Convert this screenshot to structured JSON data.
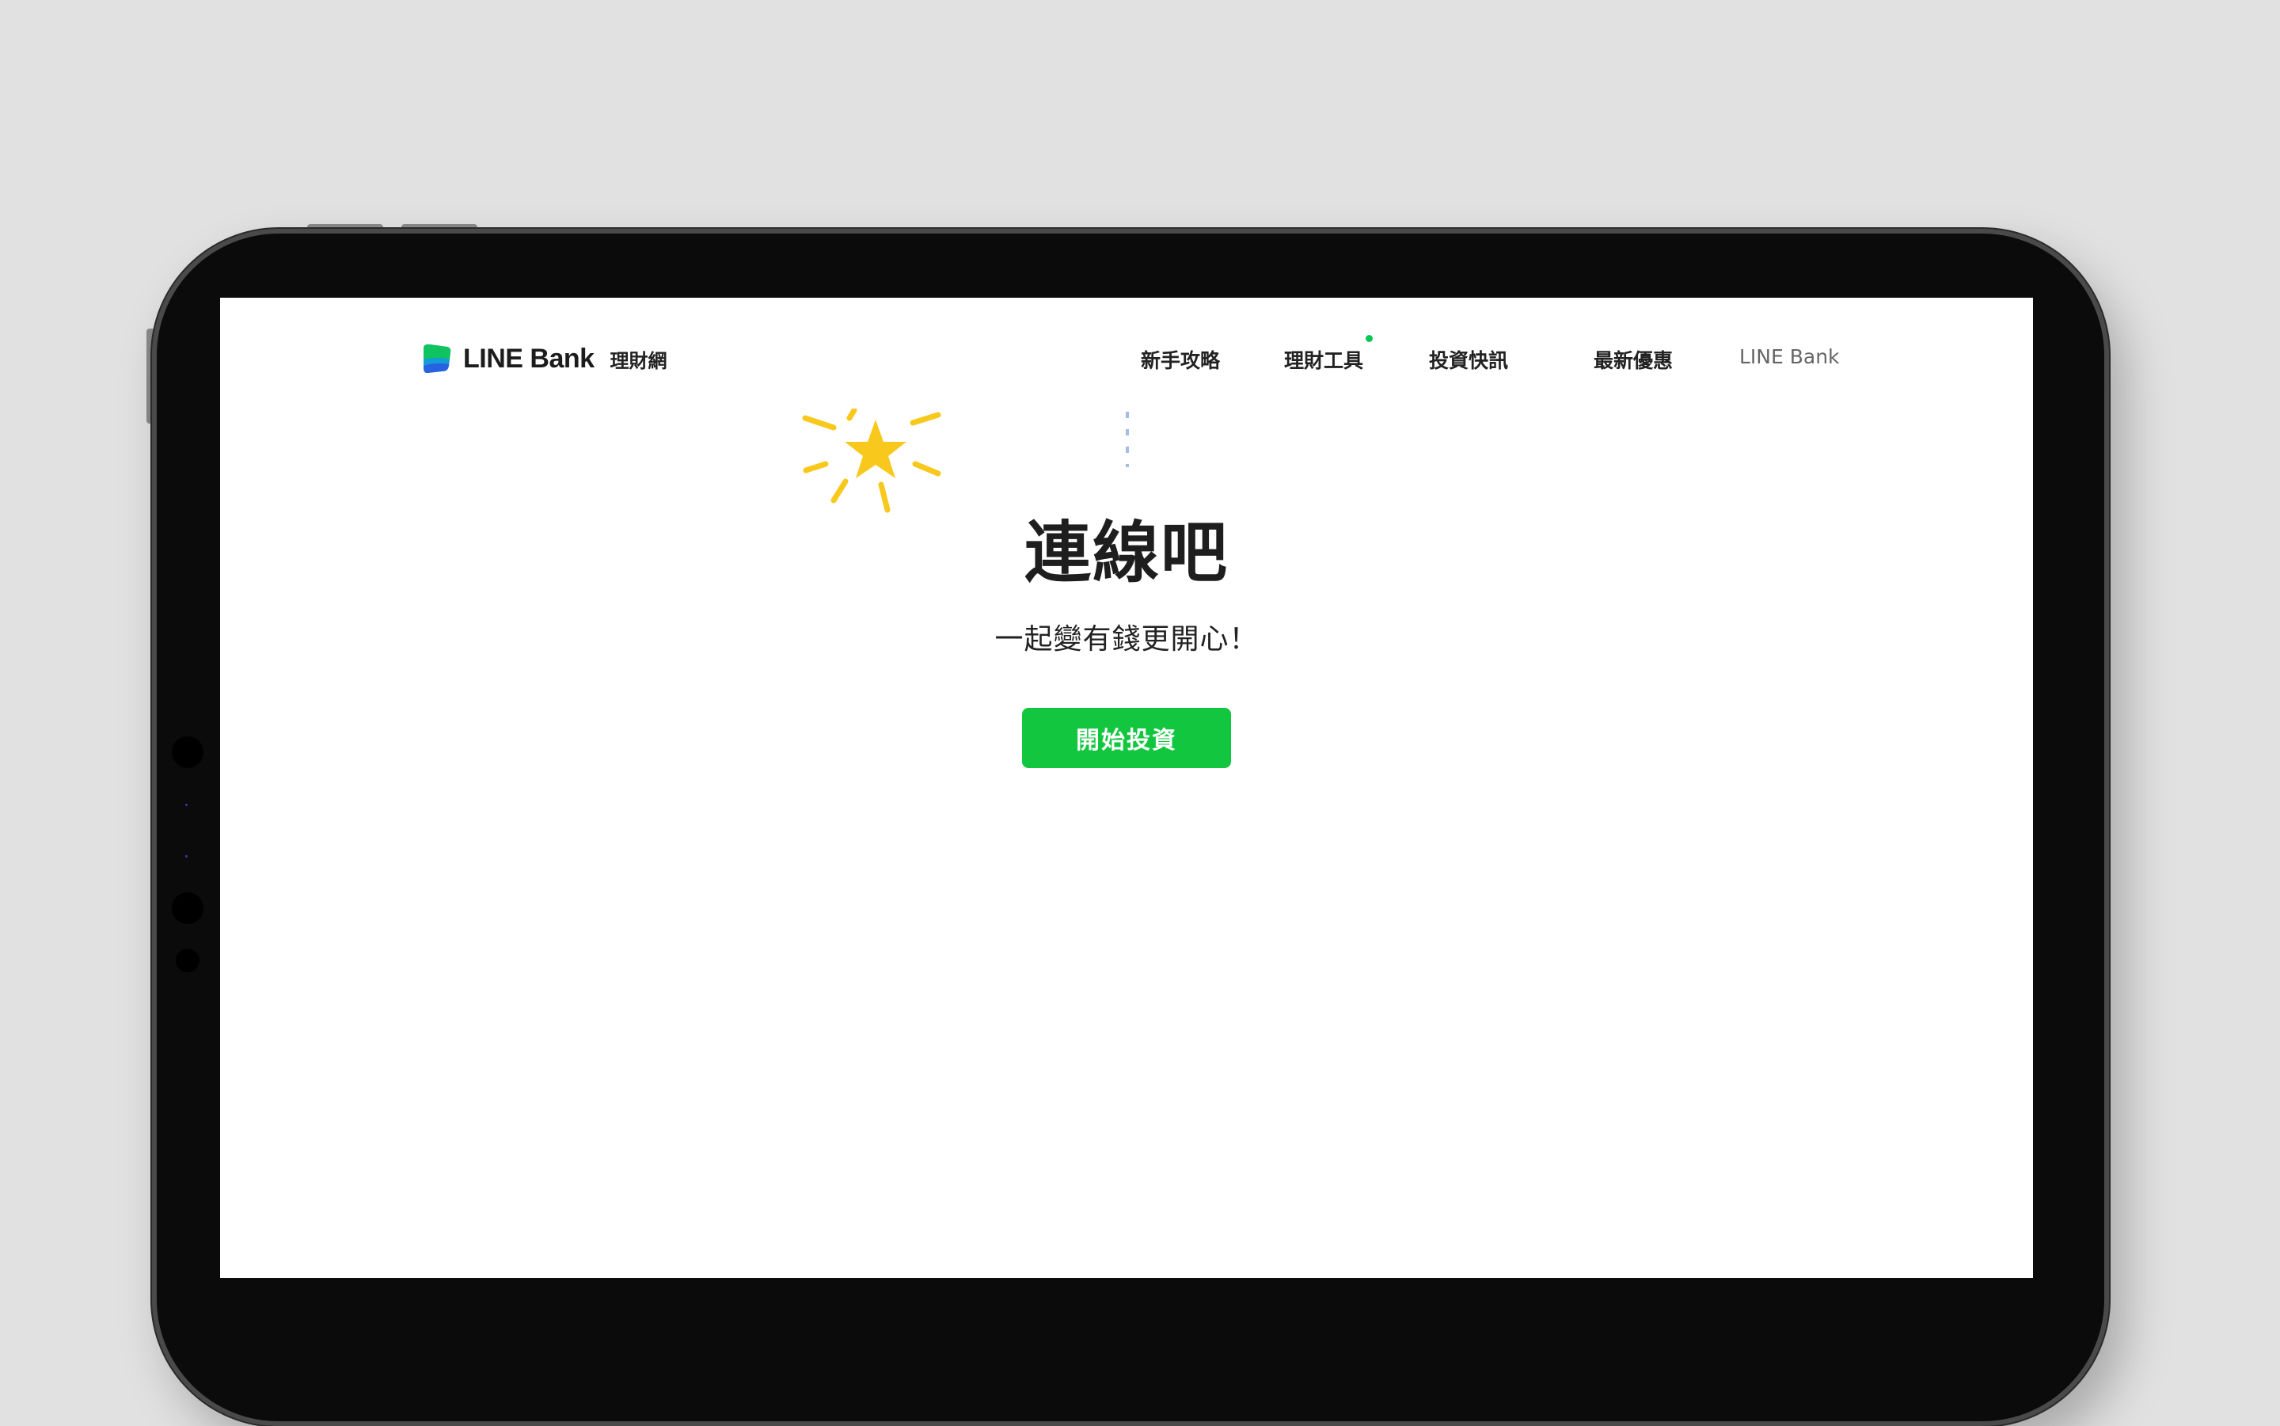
{
  "header": {
    "brand": "LINE Bank",
    "brand_sub": "理財網"
  },
  "nav": {
    "items": [
      {
        "label": "新手攻略"
      },
      {
        "label": "理財工具"
      },
      {
        "label": "投資快訊"
      },
      {
        "label": "最新優惠"
      },
      {
        "label": "LINE Bank"
      }
    ]
  },
  "hero": {
    "title": "連線吧",
    "subtitle": "一起變有錢更開心！",
    "cta_label": "開始投資"
  },
  "colors": {
    "accent_green": "#12c73f",
    "sparkle_yellow": "#f8c81c",
    "background": "#e1e1e1"
  },
  "icons": [
    "line-bank-logo-icon",
    "sparkle-star-icon",
    "notification-dot-icon"
  ]
}
